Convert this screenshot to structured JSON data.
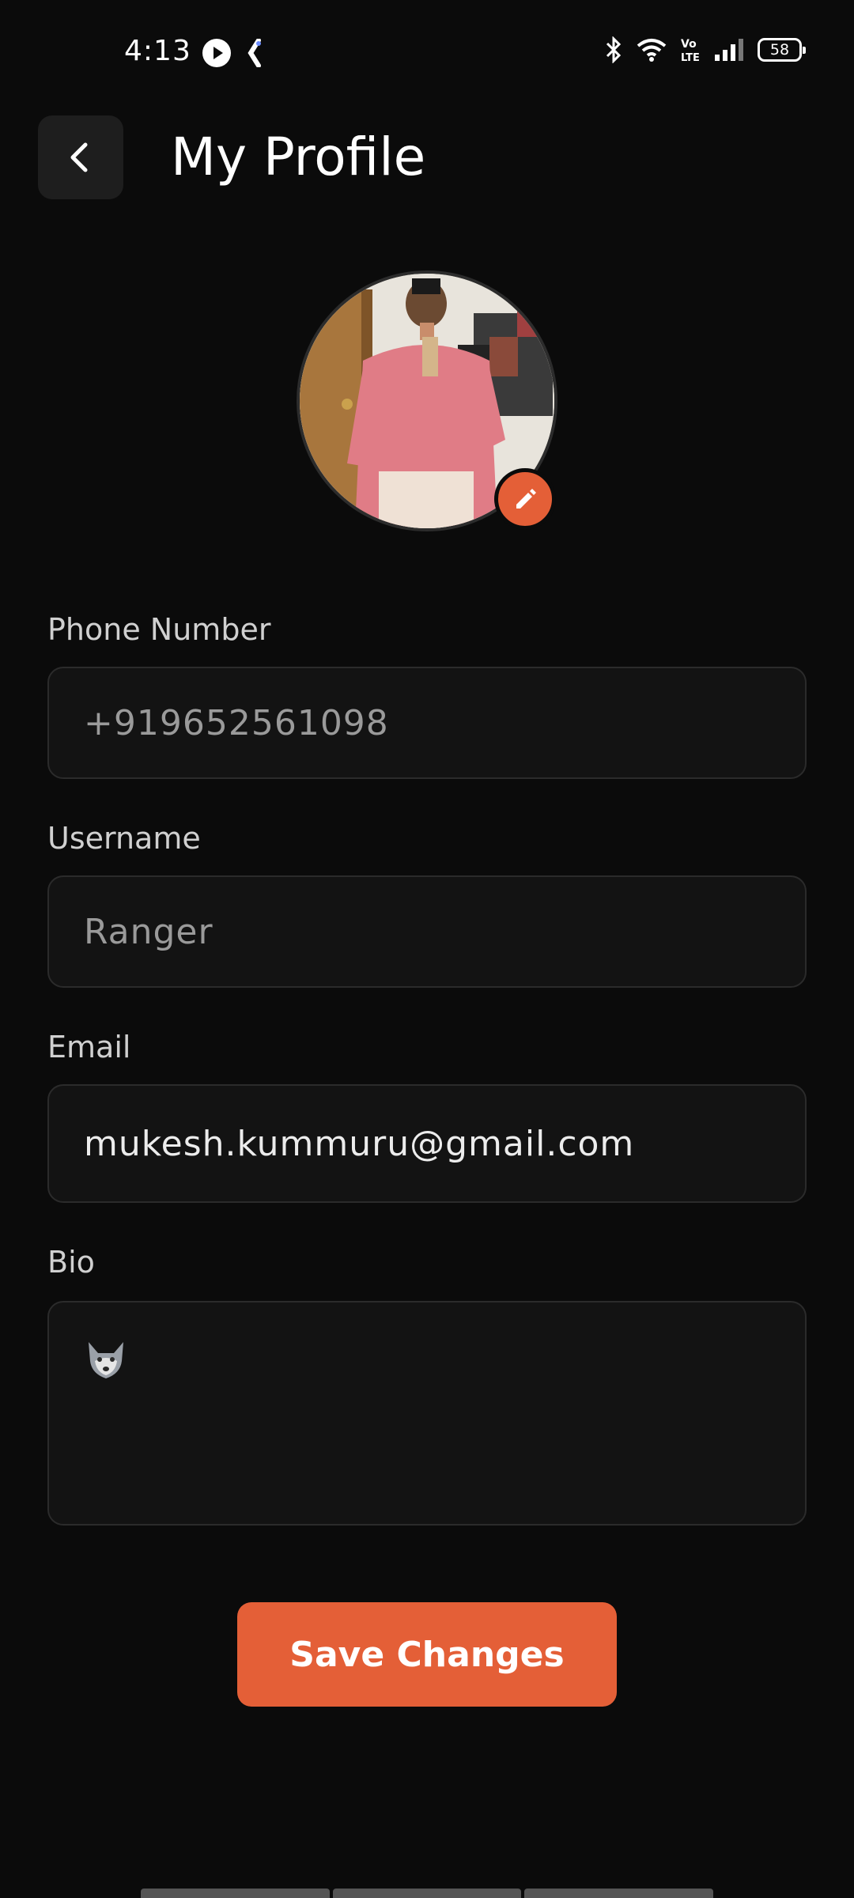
{
  "status_bar": {
    "time": "4:13",
    "left_icons": [
      "play-circle-icon",
      "app-notification-icon"
    ],
    "right_icons": [
      "bluetooth-icon",
      "wifi-icon",
      "volte-icon",
      "signal-icon"
    ],
    "volte_label": "Vo\nLTE",
    "battery": "58"
  },
  "header": {
    "back_icon": "chevron-left-icon",
    "title": "My Profile"
  },
  "avatar": {
    "edit_icon": "pencil-icon"
  },
  "form": {
    "phone": {
      "label": "Phone Number",
      "value": "+919652561098"
    },
    "username": {
      "label": "Username",
      "value": "Ranger"
    },
    "email": {
      "label": "Email",
      "value": "mukesh.kummuru@gmail.com"
    },
    "bio": {
      "label": "Bio",
      "value": "🐺"
    }
  },
  "actions": {
    "save_label": "Save Changes"
  },
  "colors": {
    "background": "#0b0b0b",
    "accent": "#e45f37",
    "field_bg": "#131313",
    "field_border": "#2b2b2b"
  }
}
